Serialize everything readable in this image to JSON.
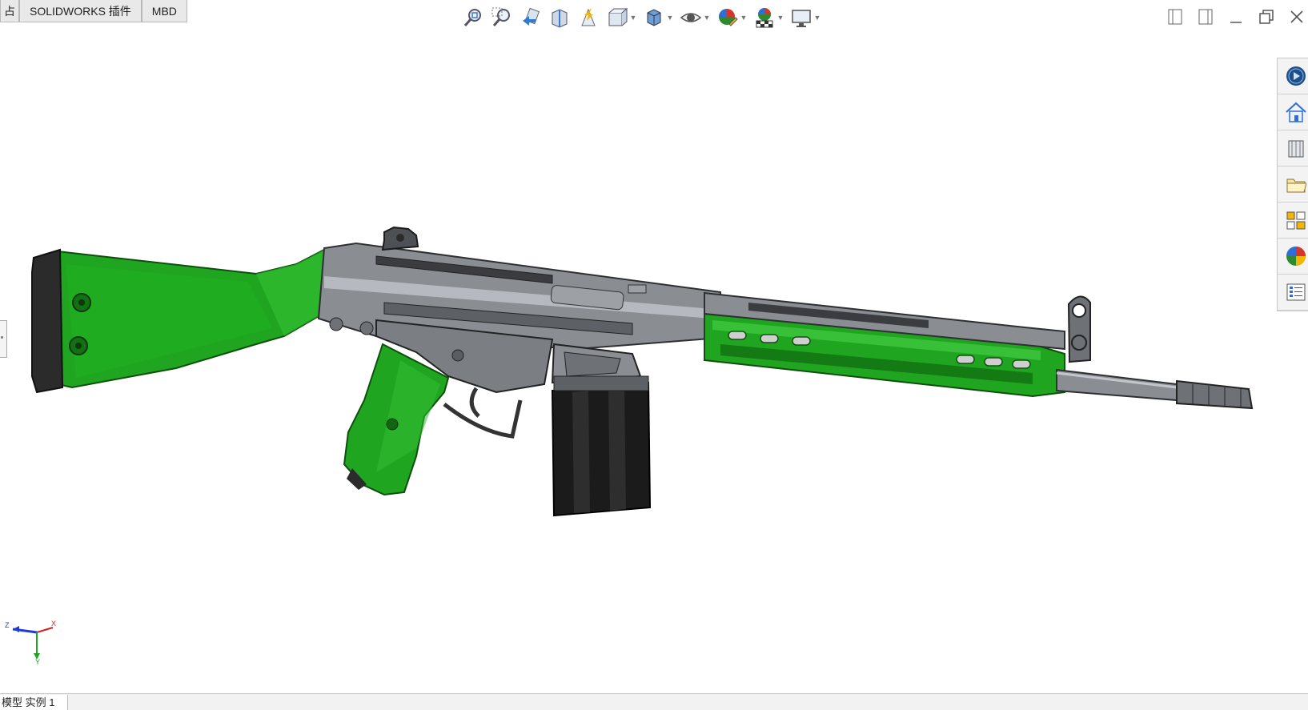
{
  "tabs": [
    {
      "label": "占"
    },
    {
      "label": "SOLIDWORKS 插件"
    },
    {
      "label": "MBD"
    }
  ],
  "hud_icons": [
    "zoom-to-fit-icon",
    "zoom-to-area-icon",
    "previous-view-icon",
    "section-view-icon",
    "dynamic-annotation-icon",
    "view-orientation-icon",
    "display-style-icon",
    "hide-show-items-icon",
    "edit-appearance-icon",
    "apply-scene-icon",
    "view-settings-icon"
  ],
  "window_controls": [
    "tile-left-icon",
    "tile-right-icon",
    "minimize-icon",
    "restore-icon",
    "close-icon"
  ],
  "task_pane": [
    "solidworks-resources-icon",
    "home-icon",
    "design-library-icon",
    "file-explorer-icon",
    "view-palette-icon",
    "appearances-icon",
    "custom-properties-icon"
  ],
  "triad": {
    "x_label": "X",
    "y_label": "Y",
    "z_label": "Z"
  },
  "bottom_tab": {
    "label": "模型 实例 1"
  },
  "colors": {
    "green": "#1fa51f",
    "metal": "#8a8e93",
    "dark": "#2b2b2b"
  }
}
